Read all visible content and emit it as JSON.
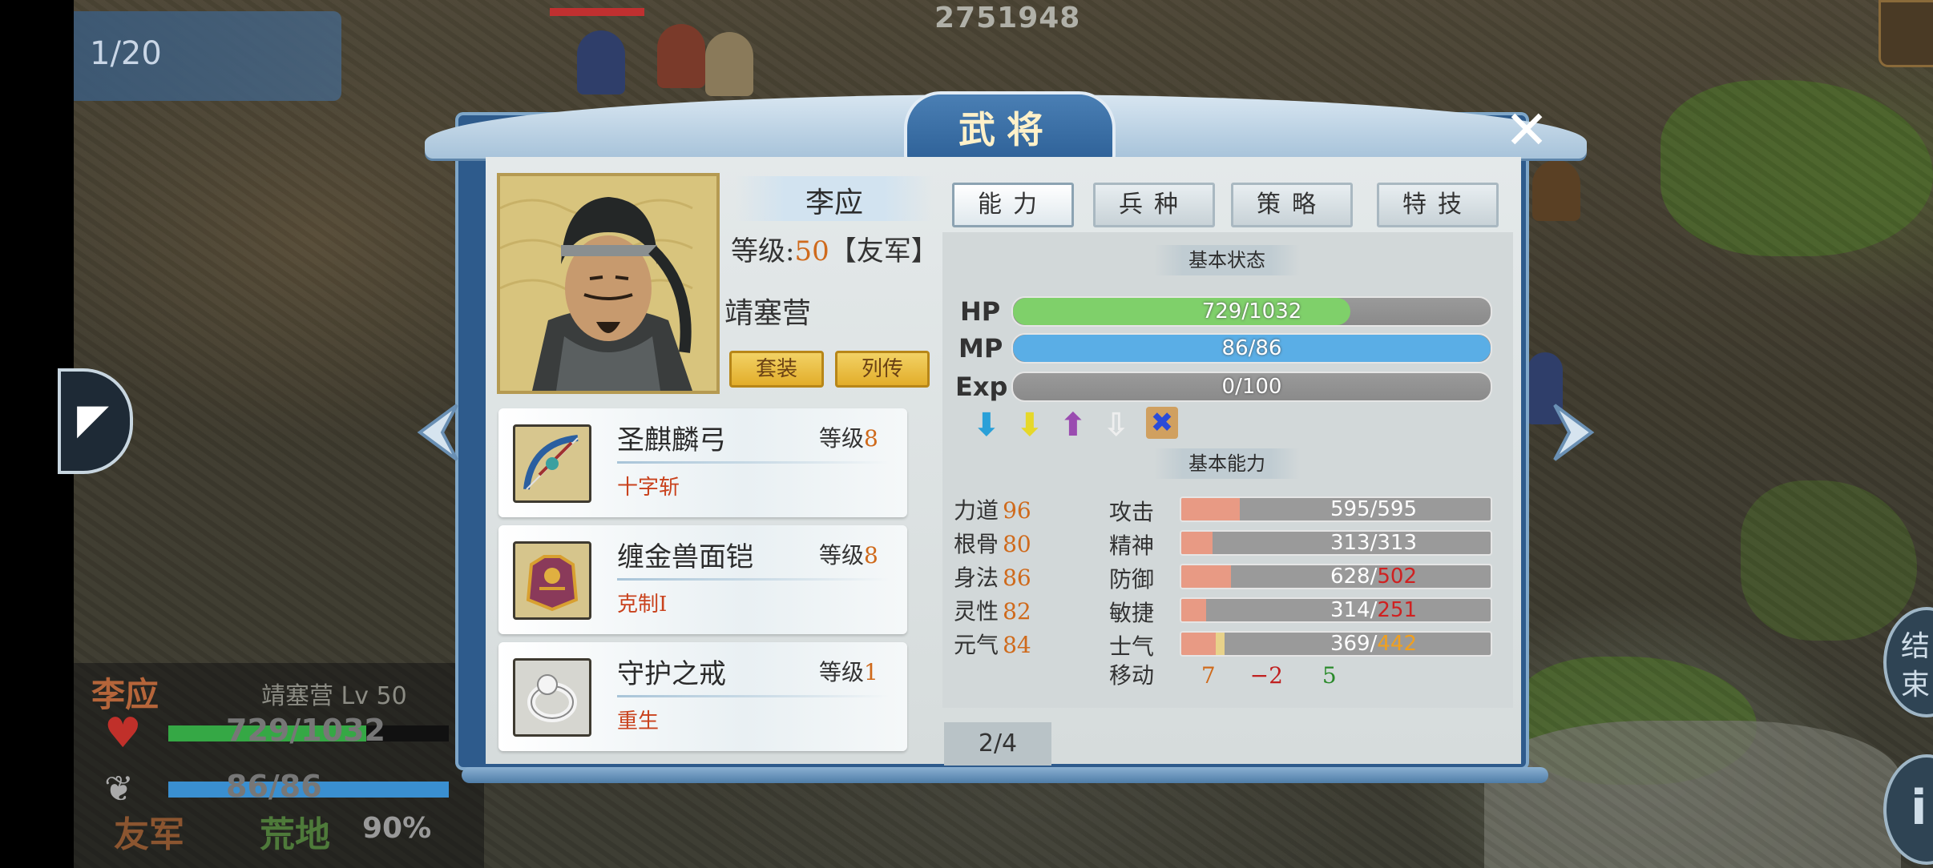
{
  "hud": {
    "turn": "1/20",
    "score": "2751948"
  },
  "unit_info": {
    "name": "李应",
    "troop_level": "靖塞营 Lv 50",
    "hp": "729/1032",
    "mp": "86/86",
    "hp_fraction": 0.706,
    "mp_fraction": 1.0,
    "army": "友军",
    "terrain": "荒地",
    "terrain_bonus": "90%"
  },
  "right_edge": {
    "end_label": "结\n束"
  },
  "dialog": {
    "title": "武将",
    "close_label": "✕",
    "name": "李应",
    "level_label": "等级:",
    "level_value": "50",
    "faction": "【友军】",
    "troop": "靖塞营",
    "buttons": {
      "outfit": "套装",
      "biography": "列传"
    },
    "tabs": [
      {
        "label": "能力",
        "active": true
      },
      {
        "label": "兵种",
        "active": false
      },
      {
        "label": "策略",
        "active": false
      },
      {
        "label": "特技",
        "active": false
      }
    ],
    "equipment": [
      {
        "name": "圣麒麟弓",
        "level_label": "等级",
        "level": "8",
        "skill": "十字斩",
        "icon": "bow-icon"
      },
      {
        "name": "缠金兽面铠",
        "level_label": "等级",
        "level": "8",
        "skill": "克制Ⅰ",
        "icon": "armor-icon"
      },
      {
        "name": "守护之戒",
        "level_label": "等级",
        "level": "1",
        "skill": "重生",
        "icon": "ring-icon"
      }
    ],
    "basic_status_title": "基本状态",
    "bars": [
      {
        "label": "HP",
        "text": "729/1032",
        "fraction": 0.706,
        "color": "#7fd06a"
      },
      {
        "label": "MP",
        "text": "86/86",
        "fraction": 1.0,
        "color": "#5aaee6"
      },
      {
        "label": "Exp",
        "text": "0/100",
        "fraction": 0.0,
        "color": "#dddddd"
      }
    ],
    "status_icons": [
      {
        "name": "attack-down-arrow-icon",
        "glyph": "⬇",
        "color": "#2aa0d8"
      },
      {
        "name": "defense-down-arrow-icon",
        "glyph": "⬇",
        "color": "#e6d82a"
      },
      {
        "name": "spirit-up-arrow-icon",
        "glyph": "⬆",
        "color": "#9a4cb0"
      },
      {
        "name": "agility-down-arrow-icon",
        "glyph": "⇩",
        "color": "#eeeeee"
      },
      {
        "name": "sealed-cross-icon",
        "glyph": "✖",
        "color": "#2a4bd8"
      }
    ],
    "basic_ability_title": "基本能力",
    "attributes": [
      {
        "name": "力道",
        "value": "96"
      },
      {
        "name": "根骨",
        "value": "80"
      },
      {
        "name": "身法",
        "value": "86"
      },
      {
        "name": "灵性",
        "value": "82"
      },
      {
        "name": "元气",
        "value": "84"
      }
    ],
    "stats": [
      {
        "name": "攻击",
        "base": "595",
        "current": "595",
        "current_color": "#ffffff",
        "fraction": 0.19
      },
      {
        "name": "精神",
        "base": "313",
        "current": "313",
        "current_color": "#ffffff",
        "fraction": 0.1
      },
      {
        "name": "防御",
        "base": "628",
        "current": "502",
        "current_color": "#d02020",
        "fraction": 0.16
      },
      {
        "name": "敏捷",
        "base": "314",
        "current": "251",
        "current_color": "#d02020",
        "fraction": 0.08
      },
      {
        "name": "士气",
        "base": "369",
        "current": "442",
        "current_color": "#f0a020",
        "fraction": 0.14
      }
    ],
    "move": {
      "label": "移动",
      "base": "7",
      "modifier": "−2",
      "total": "5"
    },
    "page": "2/4"
  }
}
